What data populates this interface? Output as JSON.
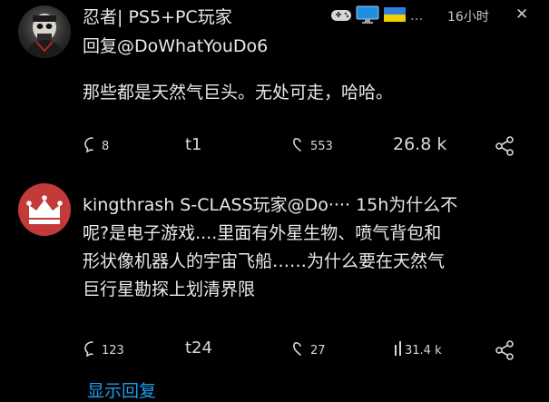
{
  "comment1": {
    "author": "忍者| PS5+PC玩家",
    "reply_to": "回复@DoWhatYouDo6",
    "time": "16小时",
    "more": "...",
    "body": "那些都是天然气巨头。无处可走，哈哈。",
    "actions": {
      "comments": "8",
      "tag": "t1",
      "likes": "553",
      "views": "26.8 k"
    }
  },
  "comment2": {
    "author_line": "kingthrash S-CLASS玩家@Do···· 15h为什么不",
    "body_lines": [
      "呢?是电子游戏....里面有外星生物、喷气背包和",
      "形状像机器人的宇宙飞船……为什么要在天然气",
      "巨行星勘探上划清界限"
    ],
    "actions": {
      "comments": "123",
      "tag": "t24",
      "likes": "27",
      "views": "31.4 k"
    }
  },
  "show_replies": "显示回复",
  "icons": {
    "badges": [
      "gamepad-icon",
      "monitor-icon",
      "ukraine-flag-icon"
    ],
    "close": "close-icon",
    "comment": "comment-icon",
    "like": "heart-icon",
    "views": "views-bar-icon",
    "share": "share-icon"
  },
  "colors": {
    "background": "#000000",
    "text": "#e7e9ea",
    "link": "#1d9bf0",
    "avatar2": "#c23a3a"
  }
}
